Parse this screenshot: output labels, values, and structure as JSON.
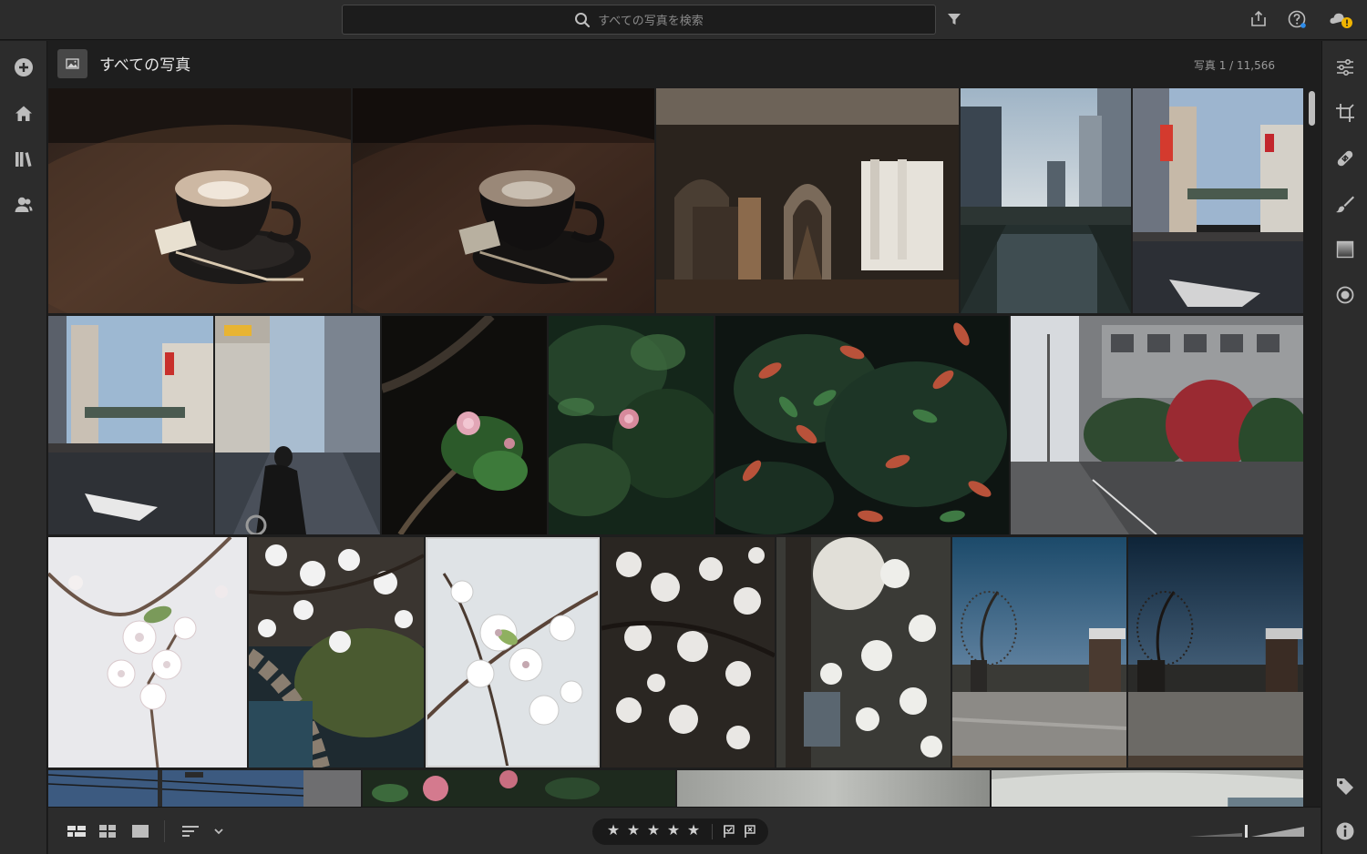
{
  "search": {
    "placeholder": "すべての写真を検索",
    "icon": "search-icon"
  },
  "header": {
    "title": "すべての写真",
    "count": "写真 1 / 11,566"
  },
  "toolbar_left": [
    "add-photos-icon",
    "home-icon",
    "library-icon",
    "people-icon"
  ],
  "toolbar_right": [
    "edit-sliders-icon",
    "crop-icon",
    "healing-icon",
    "brush-icon",
    "linear-gradient-icon",
    "radial-gradient-icon",
    "tag-icon",
    "info-icon"
  ],
  "top_right": [
    "share-icon",
    "help-icon",
    "cloud-sync-warning-icon"
  ],
  "bottom": {
    "views": [
      "photo-grid-icon",
      "square-grid-icon",
      "detail-view-icon"
    ],
    "sort": "sort-icon",
    "stars": [
      "★",
      "★",
      "★",
      "★",
      "★"
    ],
    "flags": [
      "flag-pick-icon",
      "flag-reject-icon"
    ]
  },
  "photos": [
    {
      "row": 1,
      "subject": "latte-cup"
    },
    {
      "row": 1,
      "subject": "latte-cup-dark"
    },
    {
      "row": 1,
      "subject": "clothing-store-arches"
    },
    {
      "row": 1,
      "subject": "canal-city"
    },
    {
      "row": 1,
      "subject": "city-street"
    },
    {
      "row": 2,
      "subject": "city-crossing"
    },
    {
      "row": 2,
      "subject": "cyclist-street"
    },
    {
      "row": 2,
      "subject": "camellia-flower"
    },
    {
      "row": 2,
      "subject": "camellia-leaves"
    },
    {
      "row": 2,
      "subject": "red-leaf-shrub"
    },
    {
      "row": 2,
      "subject": "sidewalk-building"
    },
    {
      "row": 3,
      "subject": "cherry-blossom-sky"
    },
    {
      "row": 3,
      "subject": "cherry-blossom-pond"
    },
    {
      "row": 3,
      "subject": "cherry-blossom-closeup",
      "selected": true
    },
    {
      "row": 3,
      "subject": "cherry-blossom-dark"
    },
    {
      "row": 3,
      "subject": "cherry-blossom-sunlight"
    },
    {
      "row": 3,
      "subject": "gate-blue-sky"
    },
    {
      "row": 3,
      "subject": "gate-blue-sky-dark"
    },
    {
      "row": 4,
      "subject": "power-lines"
    },
    {
      "row": 4,
      "subject": "camellia-pink"
    },
    {
      "row": 4,
      "subject": "grey-wall"
    },
    {
      "row": 4,
      "subject": "grey-water"
    }
  ]
}
